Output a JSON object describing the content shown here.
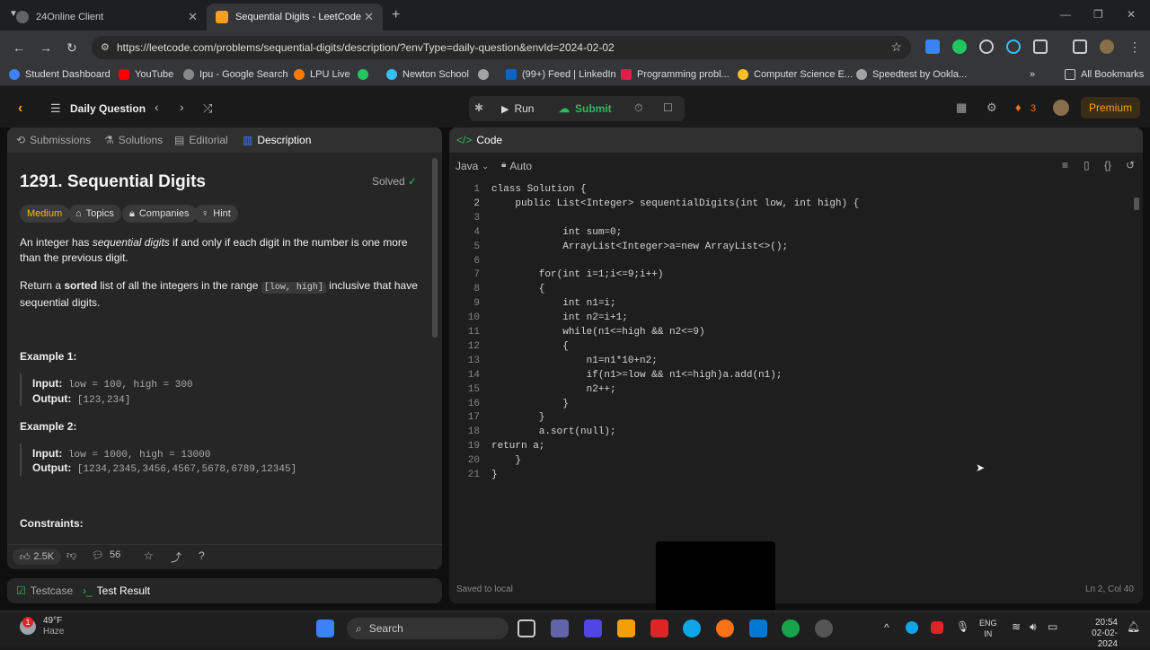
{
  "browser": {
    "tabs": [
      {
        "label": "24Online Client"
      },
      {
        "label": "Sequential Digits - LeetCode"
      }
    ],
    "url": "https://leetcode.com/problems/sequential-digits/description/?envType=daily-question&envId=2024-02-02",
    "bookmarks": [
      "Student Dashboard",
      "YouTube",
      "Ipu - Google Search",
      "LPU Live",
      "Newton School",
      "(99+) Feed | LinkedIn",
      "Programming probl...",
      "Computer Science E...",
      "Speedtest by Ookla..."
    ],
    "all_bookmarks": "All Bookmarks",
    "colors": {
      "bookmark_icons": [
        "#3b82f6",
        "#ff0000",
        "#888888",
        "#ff7a00",
        "#22c55e",
        "#0a66c2",
        "#e11d48",
        "#a3a3a3",
        "#a3a3a3"
      ]
    }
  },
  "leetcode": {
    "daily_question": "Daily Question",
    "run": "Run",
    "submit": "Submit",
    "streak": "3",
    "premium": "Premium",
    "left_tabs": [
      "Submissions",
      "Solutions",
      "Editorial",
      "Description"
    ],
    "code_tab": "Code",
    "language": "Java",
    "auto": "Auto",
    "problem": {
      "title": "1291. Sequential Digits",
      "solved": "Solved",
      "difficulty": "Medium",
      "tags": [
        "Topics",
        "Companies",
        "Hint"
      ],
      "p1_a": "An integer has ",
      "p1_em": "sequential digits",
      "p1_b": " if and only if each digit in the number is one more than the previous digit.",
      "p2_a": "Return a ",
      "p2_b": "sorted",
      "p2_c": " list of all the integers in the range ",
      "p2_code": "[low, high]",
      "p2_d": " inclusive that have sequential digits.",
      "example1_title": "Example 1:",
      "example1_input_label": "Input:",
      "example1_input": "low = 100, high = 300",
      "example1_output_label": "Output:",
      "example1_output": "[123,234]",
      "example2_title": "Example 2:",
      "example2_input_label": "Input:",
      "example2_input": "low = 1000, high = 13000",
      "example2_output_label": "Output:",
      "example2_output": "[1234,2345,3456,4567,5678,6789,12345]",
      "constraints": "Constraints:"
    },
    "likes": "2.5K",
    "comments": "56",
    "bottom_tabs": [
      "Testcase",
      "Test Result"
    ],
    "saved": "Saved to local",
    "cursor_pos": "Ln 2, Col 40",
    "code_lines": [
      "class Solution {",
      "    public List<Integer> sequentialDigits(int low, int high) {",
      "",
      "            int sum=0;",
      "            ArrayList<Integer>a=new ArrayList<>();",
      "",
      "        for(int i=1;i<=9;i++)",
      "        {",
      "            int n1=i;",
      "            int n2=i+1;",
      "            while(n1<=high && n2<=9)",
      "            {",
      "                n1=n1*10+n2;",
      "                if(n1>=low && n1<=high)a.add(n1);",
      "                n2++;",
      "            }",
      "        }",
      "        a.sort(null);",
      "return a;",
      "    }",
      "}"
    ]
  },
  "taskbar": {
    "weather_temp": "49°F",
    "weather_desc": "Haze",
    "search": "Search",
    "lang1": "ENG",
    "lang2": "IN",
    "time": "20:54",
    "date": "02-02-2024",
    "notif_count": "1"
  }
}
